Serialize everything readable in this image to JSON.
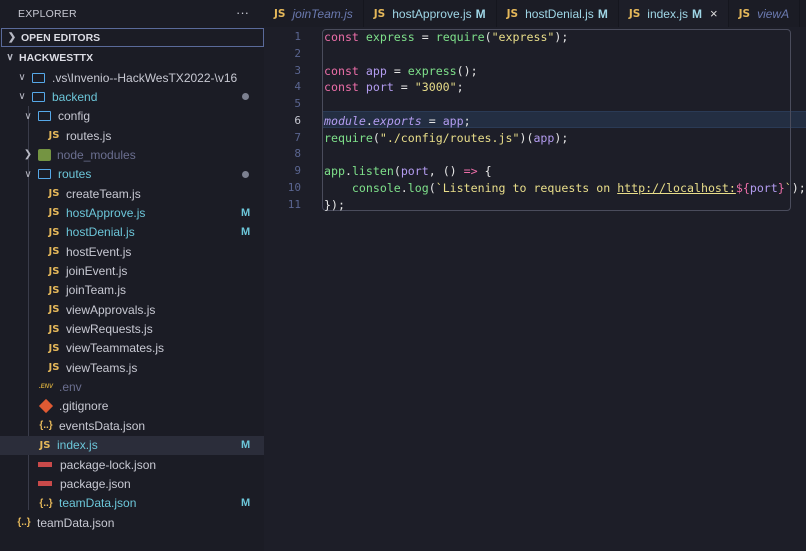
{
  "explorer": {
    "title": "EXPLORER",
    "more": "···",
    "open_editors": "OPEN EDITORS",
    "workspace": "HACKWESTTX"
  },
  "tree": [
    {
      "label": ".vs\\Invenio--HackWesTX2022-\\v16",
      "icon": "folder",
      "chev": "open",
      "indent": 0
    },
    {
      "label": "backend",
      "icon": "folder",
      "chev": "open",
      "indent": 0,
      "status": "dot",
      "cls": "mod"
    },
    {
      "label": "config",
      "icon": "folder",
      "chev": "open",
      "indent": 1
    },
    {
      "label": "routes.js",
      "icon": "js",
      "indent": 2
    },
    {
      "label": "node_modules",
      "icon": "node",
      "chev": "closed",
      "indent": 1,
      "cls": "dim"
    },
    {
      "label": "routes",
      "icon": "folder",
      "chev": "open",
      "indent": 1,
      "status": "dot",
      "cls": "mod"
    },
    {
      "label": "createTeam.js",
      "icon": "js",
      "indent": 2
    },
    {
      "label": "hostApprove.js",
      "icon": "js",
      "indent": 2,
      "status": "M",
      "cls": "mod"
    },
    {
      "label": "hostDenial.js",
      "icon": "js",
      "indent": 2,
      "status": "M",
      "cls": "mod"
    },
    {
      "label": "hostEvent.js",
      "icon": "js",
      "indent": 2
    },
    {
      "label": "joinEvent.js",
      "icon": "js",
      "indent": 2
    },
    {
      "label": "joinTeam.js",
      "icon": "js",
      "indent": 2
    },
    {
      "label": "viewApprovals.js",
      "icon": "js",
      "indent": 2
    },
    {
      "label": "viewRequests.js",
      "icon": "js",
      "indent": 2
    },
    {
      "label": "viewTeammates.js",
      "icon": "js",
      "indent": 2
    },
    {
      "label": "viewTeams.js",
      "icon": "js",
      "indent": 2
    },
    {
      "label": ".env",
      "icon": "env",
      "indent": 1,
      "cls": "dim"
    },
    {
      "label": ".gitignore",
      "icon": "git",
      "indent": 1
    },
    {
      "label": "eventsData.json",
      "icon": "json",
      "indent": 1
    },
    {
      "label": "index.js",
      "icon": "js",
      "indent": 1,
      "status": "M",
      "cls": "mod",
      "selected": true
    },
    {
      "label": "package-lock.json",
      "icon": "npm",
      "indent": 1
    },
    {
      "label": "package.json",
      "icon": "npm",
      "indent": 1
    },
    {
      "label": "teamData.json",
      "icon": "json",
      "indent": 1,
      "status": "M",
      "cls": "mod"
    },
    {
      "label": "teamData.json",
      "icon": "json",
      "indent": -1
    }
  ],
  "tabs": [
    {
      "label": "joinTeam.js",
      "preview": true
    },
    {
      "label": "hostApprove.js",
      "status": "M"
    },
    {
      "label": "hostDenial.js",
      "status": "M"
    },
    {
      "label": "index.js",
      "status": "M",
      "active": true,
      "close": "×"
    },
    {
      "label": "viewA",
      "preview": true
    }
  ],
  "tab_icon": "JS",
  "editor": {
    "current_line": 6,
    "lines": [
      [
        [
          "kw",
          "const"
        ],
        [
          "p",
          " "
        ],
        [
          "fn",
          "express"
        ],
        [
          "p",
          " = "
        ],
        [
          "fn",
          "require"
        ],
        [
          "p",
          "("
        ],
        [
          "str",
          "\"express\""
        ],
        [
          "p",
          ");"
        ]
      ],
      [],
      [
        [
          "kw",
          "const"
        ],
        [
          "p",
          " "
        ],
        [
          "var",
          "app"
        ],
        [
          "p",
          " = "
        ],
        [
          "fn",
          "express"
        ],
        [
          "p",
          "();"
        ]
      ],
      [
        [
          "kw",
          "const"
        ],
        [
          "p",
          " "
        ],
        [
          "var",
          "port"
        ],
        [
          "p",
          " = "
        ],
        [
          "str",
          "\"3000\""
        ],
        [
          "p",
          ";"
        ]
      ],
      [],
      [
        [
          "it",
          "module"
        ],
        [
          "p",
          "."
        ],
        [
          "it",
          "exports"
        ],
        [
          "p",
          " = "
        ],
        [
          "var",
          "app"
        ],
        [
          "p",
          ";"
        ]
      ],
      [
        [
          "fn",
          "require"
        ],
        [
          "p",
          "("
        ],
        [
          "str",
          "\"./config/routes.js\""
        ],
        [
          "p",
          ")("
        ],
        [
          "var",
          "app"
        ],
        [
          "p",
          ");"
        ]
      ],
      [],
      [
        [
          "fn",
          "app"
        ],
        [
          "p",
          "."
        ],
        [
          "fn",
          "listen"
        ],
        [
          "p",
          "("
        ],
        [
          "var",
          "port"
        ],
        [
          "p",
          ", () "
        ],
        [
          "kw",
          "=>"
        ],
        [
          "p",
          " {"
        ]
      ],
      [
        [
          "p",
          "    "
        ],
        [
          "fn",
          "console"
        ],
        [
          "p",
          "."
        ],
        [
          "fn",
          "log"
        ],
        [
          "p",
          "("
        ],
        [
          "str",
          "`Listening to requests on "
        ],
        [
          "url",
          "http://localhost:"
        ],
        [
          "tpl",
          "${"
        ],
        [
          "var",
          "port"
        ],
        [
          "tpl",
          "}"
        ],
        [
          "str",
          "`"
        ],
        [
          "p",
          ");"
        ]
      ],
      [
        [
          "p",
          "});"
        ]
      ]
    ]
  }
}
